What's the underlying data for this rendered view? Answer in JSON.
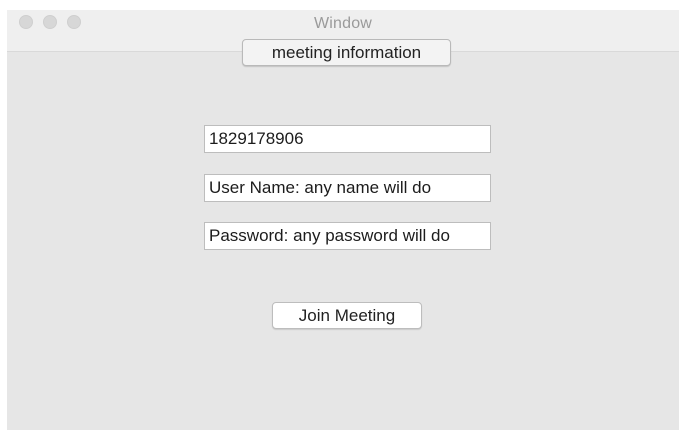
{
  "window": {
    "title": "Window"
  },
  "tab": {
    "label": "meeting information"
  },
  "form": {
    "meeting_id_value": "1829178906",
    "username_placeholder": "User Name: any name will do",
    "password_placeholder": "Password: any password will do",
    "join_label": "Join Meeting"
  },
  "colors": {
    "window_background": "#e6e6e6",
    "titlebar_background": "#efefef",
    "field_background": "#ffffff"
  }
}
